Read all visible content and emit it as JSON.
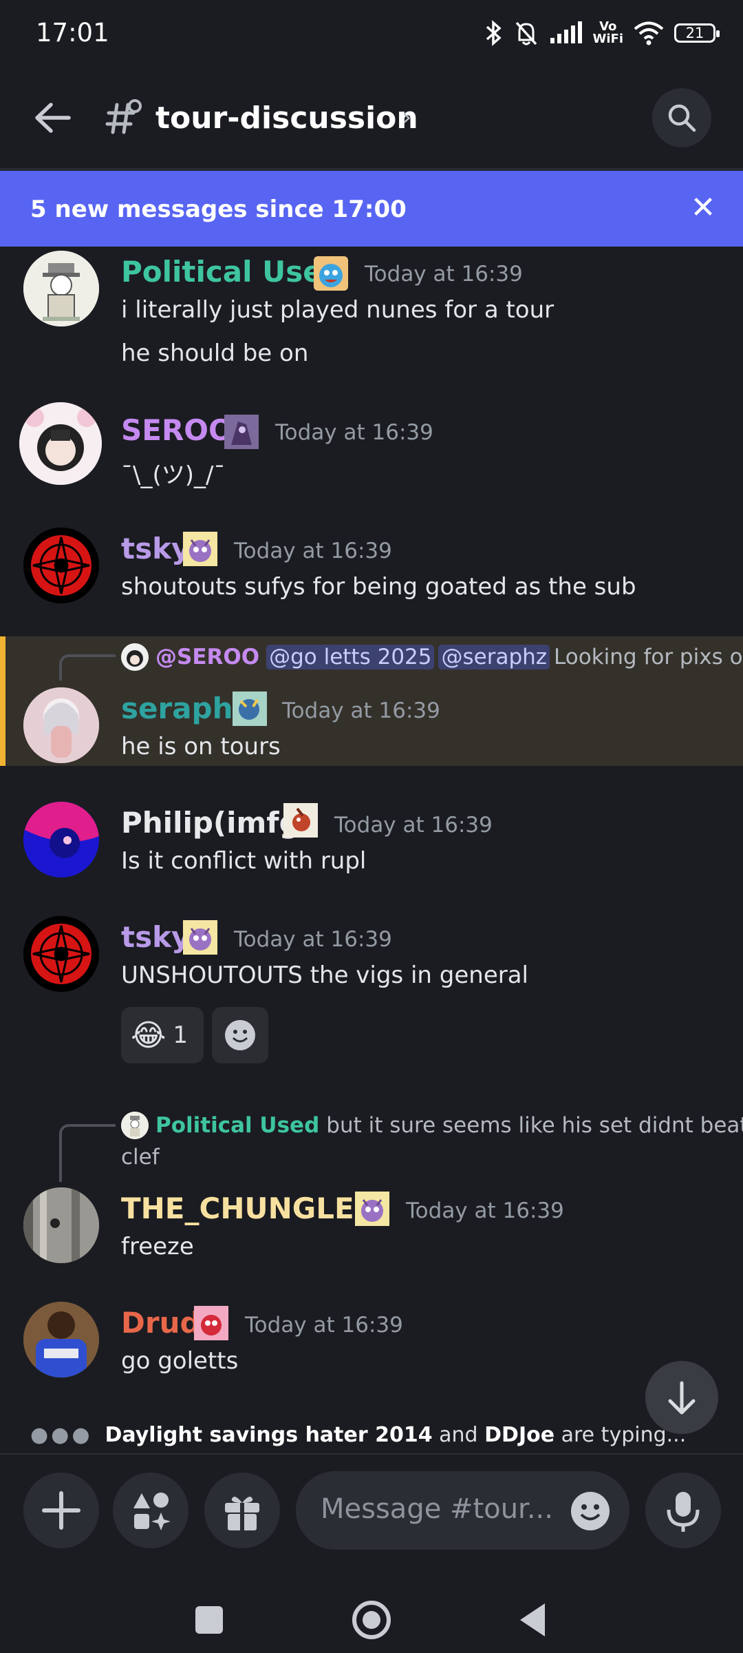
{
  "status_bar": {
    "time": "17:01",
    "vowifi_line1": "Vo",
    "vowifi_line2": "WiFi",
    "battery": "21"
  },
  "header": {
    "channel_name": "tour-discussion"
  },
  "banner": {
    "text": "5 new messages since 17:00",
    "close": "✕"
  },
  "messages": [
    {
      "author": "Political Used",
      "author_color": "#3ec5a0",
      "timestamp": "Today at 16:39",
      "lines": [
        "i literally just played nunes for a tour",
        "he should be on"
      ]
    },
    {
      "author": "SEROO",
      "author_color": "#c58af0",
      "timestamp": "Today at 16:39",
      "lines": [
        "¯\\_(ツ)_/¯"
      ]
    },
    {
      "author": "tsky",
      "author_color": "#b89ae8",
      "timestamp": "Today at 16:39",
      "lines": [
        "shoutouts sufys for being goated as the sub"
      ]
    },
    {
      "author": "seraphz",
      "author_color": "#2ea3a0",
      "timestamp": "Today at 16:39",
      "lines": [
        "he is on tours"
      ],
      "reply": {
        "author": "@SEROO",
        "author_color": "#c58af0",
        "mention1": "@go letts 2025",
        "mention2": "@seraphz",
        "text": "Looking for pixs opp"
      }
    },
    {
      "author": "Philip(imfg)",
      "author_color": "#e8e9eb",
      "timestamp": "Today at 16:39",
      "lines": [
        "Is it conflict with rupl"
      ]
    },
    {
      "author": "tsky",
      "author_color": "#b89ae8",
      "timestamp": "Today at 16:39",
      "lines": [
        "UNSHOUTOUTS the vigs in general"
      ],
      "reactions": [
        {
          "emoji": "😂",
          "count": "1"
        }
      ]
    },
    {
      "author": "THE_CHUNGLER",
      "author_color": "#f8e1a0",
      "timestamp": "Today at 16:39",
      "lines": [
        "freeze"
      ],
      "reply": {
        "author": "Political Used",
        "author_color": "#3ec5a0",
        "text_line1": "but it sure seems like his set didnt beat",
        "text_line2": "clef"
      }
    },
    {
      "author": "Drud",
      "author_color": "#e8674a",
      "timestamp": "Today at 16:39",
      "lines": [
        "go goletts"
      ]
    }
  ],
  "typing": {
    "users": "Daylight savings hater 2014",
    "joiner": "and",
    "user2": "DDJoe",
    "suffix": "are typing..."
  },
  "composer": {
    "placeholder": "Message #tour..."
  },
  "icons": [
    "back-arrow-icon",
    "channel-thread-icon",
    "search-icon",
    "close-icon",
    "arrow-down-icon",
    "plus-icon",
    "apps-icon",
    "gift-icon",
    "emoji-icon",
    "microphone-icon",
    "nav-recents-icon",
    "nav-home-icon",
    "nav-back-icon",
    "bluetooth-icon",
    "bell-off-icon",
    "signal-icon",
    "wifi-icon"
  ]
}
